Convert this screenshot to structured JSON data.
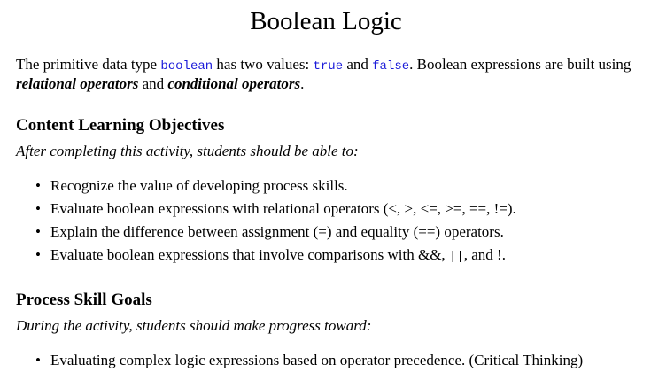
{
  "title": "Boolean Logic",
  "intro": {
    "t1": "The primitive data type ",
    "code_boolean": "boolean",
    "t2": " has two values: ",
    "code_true": "true",
    "t3": " and ",
    "code_false": "false",
    "t4": ". Boolean expressions are built using ",
    "em_relational": "relational operators",
    "t5": " and ",
    "em_conditional": "conditional operators",
    "t6": "."
  },
  "objectives": {
    "heading": "Content Learning Objectives",
    "lead": "After completing this activity, students should be able to:",
    "items": [
      "Recognize the value of developing process skills.",
      "Evaluate boolean expressions with relational operators (<, >, <=, >=, ==, !=).",
      "Explain the difference between assignment (=) and equality (==) operators."
    ],
    "item4": {
      "before": "Evaluate boolean expressions that involve comparisons with &&, ",
      "code_or": "||",
      "after": ", and !."
    }
  },
  "goals": {
    "heading": "Process Skill Goals",
    "lead": "During the activity, students should make progress toward:",
    "items": [
      "Evaluating complex logic expressions based on operator precedence. (Critical Thinking)"
    ]
  }
}
